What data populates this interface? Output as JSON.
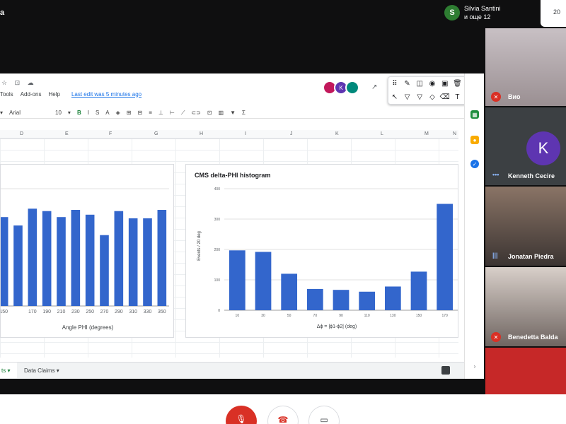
{
  "meet": {
    "top_left_label": "a",
    "presenter_avatar": "S",
    "presenter_name": "Silvia Santini",
    "presenter_sub": "и още 12",
    "top_right": "20"
  },
  "sheets": {
    "menu": [
      "Tools",
      "Add-ons",
      "Help"
    ],
    "last_edit": "Last edit was 5 minutes ago",
    "font": "Arial",
    "font_size": "10",
    "collaborators": [
      {
        "letter": "",
        "color": "#c2185b"
      },
      {
        "letter": "K",
        "color": "#5e35b1"
      },
      {
        "letter": "",
        "color": "#00897b"
      }
    ],
    "columns": [
      "D",
      "E",
      "F",
      "G",
      "H",
      "I",
      "J",
      "K",
      "L",
      "M",
      "N"
    ],
    "sheet_tab_1": "ts",
    "sheet_tab_2": "Data Claims"
  },
  "chart_data": [
    {
      "type": "bar",
      "title": "",
      "xlabel": "Angle PHI (degrees)",
      "ylabel": "",
      "categories": [
        "150",
        "",
        "170",
        "190",
        "210",
        "230",
        "250",
        "270",
        "290",
        "310",
        "330",
        "350"
      ],
      "values": [
        74,
        67,
        81,
        79,
        74,
        80,
        76,
        59,
        79,
        73,
        73,
        80
      ],
      "ylim": [
        0,
        100
      ]
    },
    {
      "type": "bar",
      "title": "CMS delta-PHI histogram",
      "xlabel": "Δϕ = |ϕ1-ϕ2| (deg)",
      "ylabel": "Events / 20 deg",
      "categories": [
        "10",
        "30",
        "50",
        "70",
        "90",
        "110",
        "130",
        "150",
        "170"
      ],
      "values": [
        197,
        192,
        120,
        70,
        67,
        61,
        78,
        127,
        350
      ],
      "ylim": [
        0,
        400
      ],
      "yticks": [
        0,
        100,
        200,
        300,
        400
      ]
    }
  ],
  "participants": [
    {
      "name": "Вио",
      "muted": true
    },
    {
      "name": "Kenneth Cecire",
      "avatar": "K",
      "muted": false
    },
    {
      "name": "Jonatan Piedra",
      "muted": false
    },
    {
      "name": "Benedetta Balda",
      "muted": true
    },
    {
      "name": "",
      "muted": false
    }
  ],
  "icons": {
    "mic_off": "mic-off-icon",
    "end_call": "end-call-icon",
    "present": "present-icon"
  }
}
